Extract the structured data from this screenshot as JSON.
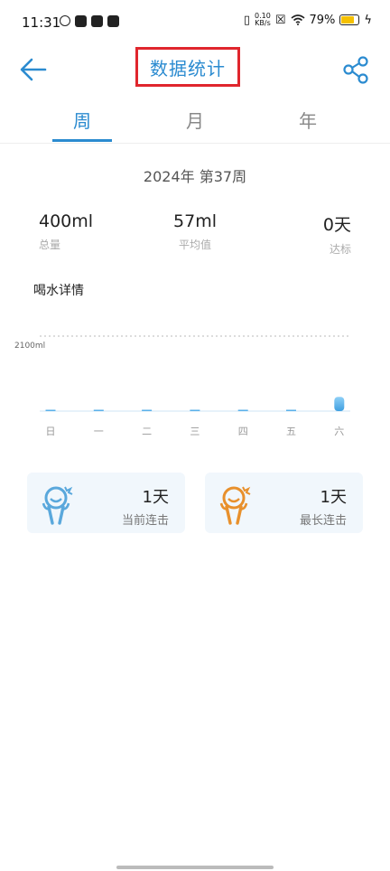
{
  "status_bar": {
    "time": "11:31",
    "net_speed_value": "0.10",
    "net_speed_unit": "KB/s",
    "battery_percent": "79%",
    "battery_level": 0.79
  },
  "header": {
    "title": "数据统计"
  },
  "tabs": [
    {
      "label": "周",
      "active": true
    },
    {
      "label": "月",
      "active": false
    },
    {
      "label": "年",
      "active": false
    }
  ],
  "period_label": "2024年 第37周",
  "stats": [
    {
      "value": "400ml",
      "label": "总量"
    },
    {
      "value": "57ml",
      "label": "平均值"
    },
    {
      "value": "0天",
      "label": "达标"
    }
  ],
  "section_title": "喝水详情",
  "chart_data": {
    "type": "bar",
    "categories": [
      "日",
      "一",
      "二",
      "三",
      "四",
      "五",
      "六"
    ],
    "values": [
      0,
      0,
      0,
      0,
      0,
      0,
      400
    ],
    "goal_line": 2100,
    "goal_label": "2100ml",
    "ylim": [
      0,
      2100
    ],
    "colors": {
      "bar": "#5ab0ea",
      "goal_line": "#c8c8c8",
      "axis": "#cfe4f4"
    }
  },
  "cards": [
    {
      "value": "1天",
      "caption": "当前连击",
      "color": "#5aa8dc"
    },
    {
      "value": "1天",
      "caption": "最长连击",
      "color": "#e8902c"
    }
  ],
  "colors": {
    "accent": "#2b8bd0",
    "highlight_box": "#e0262d"
  }
}
